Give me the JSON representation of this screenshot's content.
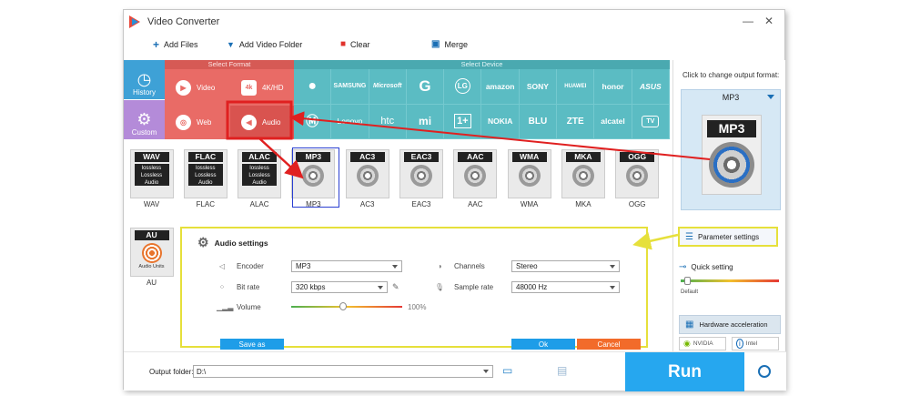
{
  "window": {
    "title": "Video Converter",
    "minimize": "—",
    "close": "✕"
  },
  "toolbar": {
    "add_files": "Add Files",
    "add_video_folder": "Add Video Folder",
    "clear": "Clear",
    "merge": "Merge"
  },
  "nav": {
    "history": "History",
    "custom": "Custom"
  },
  "select_format": {
    "header": "Select Format",
    "categories": [
      {
        "label": "Video"
      },
      {
        "label": "4K/HD"
      },
      {
        "label": "Web"
      },
      {
        "label": "Audio"
      }
    ],
    "icon_labels": [
      "4k"
    ]
  },
  "select_device": {
    "header": "Select Device",
    "brands_row1": [
      "",
      "SAMSUNG",
      "Microsoft",
      "G",
      "LG",
      "amazon",
      "SONY",
      "HUAWEI",
      "honor",
      "ASUS"
    ],
    "brands_row2": [
      "",
      "Lenovo",
      "htc",
      "mi",
      "1+",
      "NOKIA",
      "BLU",
      "ZTE",
      "alcatel",
      "TV"
    ]
  },
  "formats": [
    {
      "label": "WAV",
      "name": "WAV",
      "lossless": true
    },
    {
      "label": "FLAC",
      "name": "FLAC",
      "lossless": true
    },
    {
      "label": "ALAC",
      "name": "ALAC",
      "lossless": true
    },
    {
      "label": "MP3",
      "name": "MP3",
      "lossless": false
    },
    {
      "label": "AC3",
      "name": "AC3",
      "lossless": false
    },
    {
      "label": "EAC3",
      "name": "EAC3",
      "lossless": false
    },
    {
      "label": "AAC",
      "name": "AAC",
      "lossless": false
    },
    {
      "label": "WMA",
      "name": "WMA",
      "lossless": false
    },
    {
      "label": "MKA",
      "name": "MKA",
      "lossless": false
    },
    {
      "label": "OGG",
      "name": "OGG",
      "lossless": false
    },
    {
      "label": "AU",
      "name": "AU",
      "lossless": false
    }
  ],
  "lossless_text": {
    "line1": "lossless",
    "line2": "Lossless",
    "line3": "Audio"
  },
  "au_text": "Audio Units",
  "output_panel": {
    "click_to_change": "Click to change output format:",
    "selected_format": "MP3",
    "icon_label": "MP3",
    "parameter_settings": "Parameter settings",
    "quick_setting": "Quick setting",
    "default_label": "Default",
    "hardware_acceleration": "Hardware acceleration",
    "nvidia": "NVIDIA",
    "intel": "Intel"
  },
  "audio_settings": {
    "title": "Audio settings",
    "encoder_label": "Encoder",
    "encoder_value": "MP3",
    "channels_label": "Channels",
    "channels_value": "Stereo",
    "bitrate_label": "Bit rate",
    "bitrate_value": "320 kbps",
    "samplerate_label": "Sample rate",
    "samplerate_value": "48000 Hz",
    "volume_label": "Volume",
    "volume_value": "100%",
    "volume_level": 0.47,
    "save_as": "Save as",
    "ok": "Ok",
    "cancel": "Cancel"
  },
  "bottom": {
    "output_folder_label": "Output folder:",
    "output_folder_value": "D:\\",
    "run": "Run"
  },
  "colors": {
    "format_panel": "#e96b66",
    "device_panel": "#5bbcc3",
    "history_nav": "#3ea1d6",
    "custom_nav": "#b48bd9",
    "run_button": "#26a7ef",
    "highlight_yellow": "#e6e03b",
    "highlight_red": "#e02020",
    "ok_button": "#1e9de8",
    "cancel_button": "#f26b2a",
    "save_button": "#1e9de8"
  }
}
